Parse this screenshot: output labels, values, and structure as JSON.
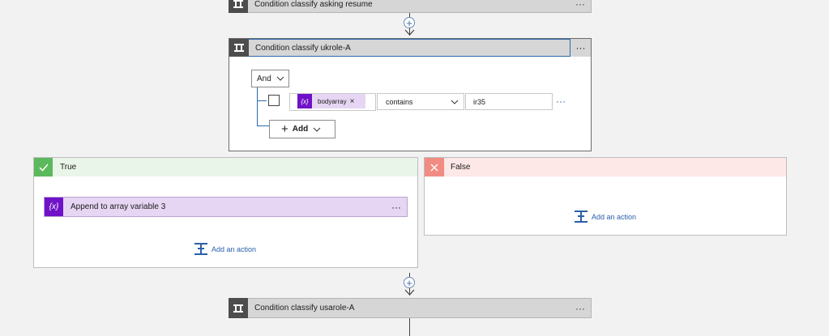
{
  "flow": {
    "top_condition": {
      "title": "Condition classify asking resume",
      "more": "···"
    },
    "active_condition": {
      "title": "Condition classify ukrole-A",
      "more": "···",
      "group_operator": "And",
      "row": {
        "token_icon": "{x}",
        "token_label": "bodyarray",
        "token_remove": "×",
        "operator": "contains",
        "value": "ir35",
        "more": "···"
      },
      "add_label": "Add"
    },
    "true_branch": {
      "label": "True",
      "action": {
        "icon": "{x}",
        "title": "Append to array variable 3",
        "more": "···"
      },
      "add_action_label": "Add an action"
    },
    "false_branch": {
      "label": "False",
      "add_action_label": "Add an action"
    },
    "bottom_condition": {
      "title": "Condition classify usarole-A",
      "more": "···"
    }
  },
  "colors": {
    "true_header": "#e9f5e9",
    "false_header": "#fde7e7",
    "check_green": "#5cb85c",
    "false_red": "#f28b82",
    "variable_purple": "#6f12c8"
  },
  "icons": {
    "condition": "condition-icon",
    "insert": "plus-icon",
    "variable": "variable-icon",
    "check": "check-icon",
    "close": "close-icon",
    "chevron": "chevron-down-icon",
    "add_action": "add-action-icon"
  }
}
